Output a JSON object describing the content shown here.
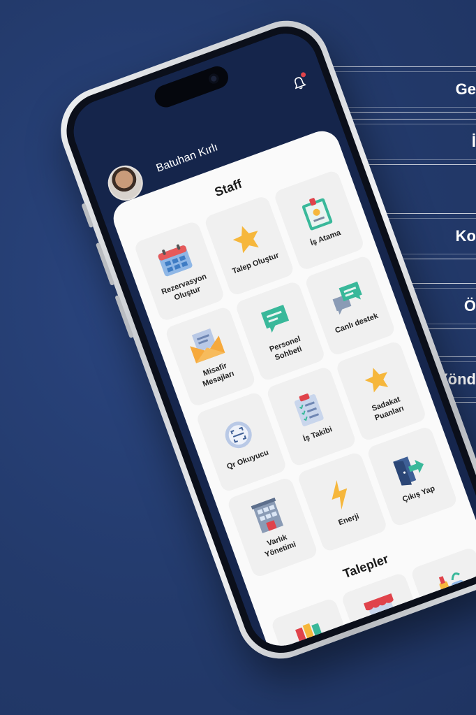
{
  "callouts": [
    {
      "label": "Ge"
    },
    {
      "label": "İ"
    },
    {
      "label": "Ko"
    },
    {
      "label": "Ö"
    },
    {
      "label": "Yönd"
    }
  ],
  "user": {
    "name": "Batuhan Kırlı"
  },
  "sections": {
    "staff_title": "Staff",
    "requests_title": "Talepler"
  },
  "tiles": [
    {
      "label": "Rezervasyon\nOluştur",
      "icon": "calendar-icon"
    },
    {
      "label": "Talep Oluştur",
      "icon": "star-icon"
    },
    {
      "label": "İş Atama",
      "icon": "id-badge-icon"
    },
    {
      "label": "Misafir\nMesajları",
      "icon": "envelope-icon"
    },
    {
      "label": "Personel\nSohbeti",
      "icon": "chat-bubble-icon"
    },
    {
      "label": "Canlı destek",
      "icon": "chat-bubbles-icon"
    },
    {
      "label": "Qr Okuyucu",
      "icon": "qr-scan-icon"
    },
    {
      "label": "İş Takibi",
      "icon": "clipboard-checklist-icon"
    },
    {
      "label": "Sadakat\nPuanları",
      "icon": "star-icon"
    },
    {
      "label": "Varlık\nYönetimi",
      "icon": "building-icon"
    },
    {
      "label": "Enerji",
      "icon": "lightning-icon"
    },
    {
      "label": "Çıkış Yap",
      "icon": "exit-door-icon"
    }
  ],
  "request_tiles": [
    {
      "icon": "books-icon"
    },
    {
      "icon": "shop-icon"
    },
    {
      "icon": "cleaning-supplies-icon"
    }
  ],
  "colors": {
    "background": "#233a6b",
    "header": "#15254b",
    "star": "#f6b73c",
    "teal": "#39b89a",
    "accent_red": "#e0434b"
  }
}
